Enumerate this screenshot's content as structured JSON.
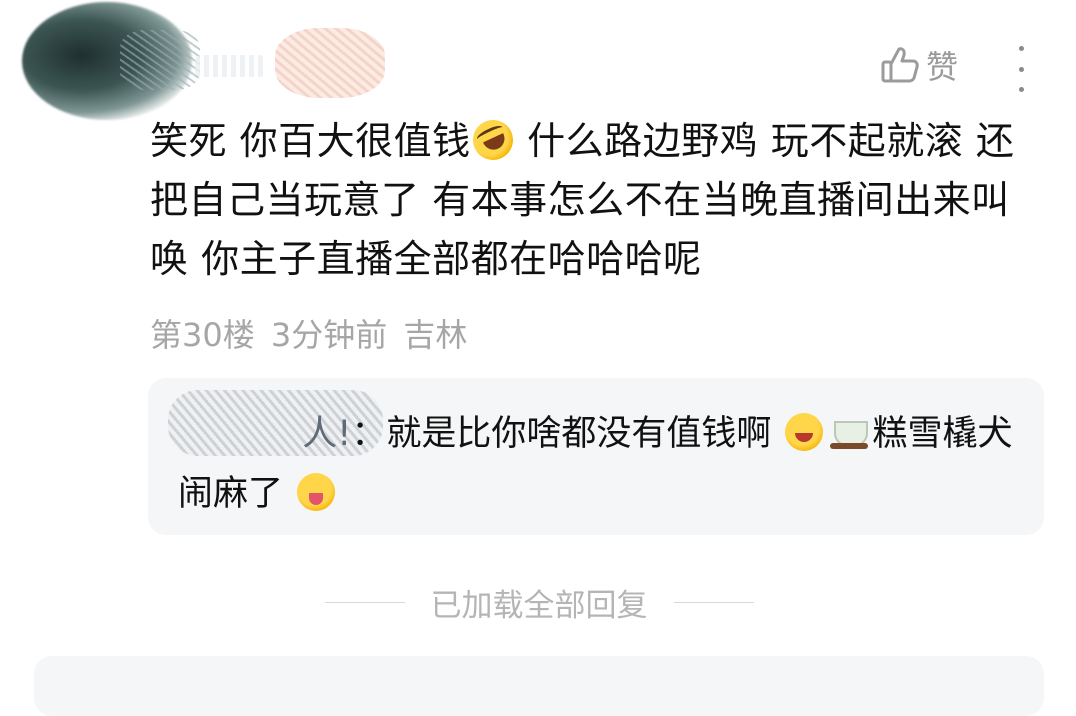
{
  "comment": {
    "like_label": "赞",
    "text_parts": [
      "笑死 你百大很值钱",
      " 什么路边野鸡 玩不起就滚 还把自己当玩意了 有本事怎么不在当晚直播间出来叫唤 你主子直播全部都在哈哈哈呢"
    ],
    "meta": "第30楼 3分钟前 吉林"
  },
  "reply": {
    "author_suffix": "人!",
    "separator": "：",
    "text_parts": [
      "就是比你啥都没有值钱啊",
      "",
      "糕雪橇犬闹麻了"
    ]
  },
  "footer": {
    "loaded_text": "已加载全部回复"
  },
  "icons": {
    "like": "thumbs-up-icon",
    "more": "more-vertical-icon",
    "emoji_laugh": "rolling-laughing-emoji",
    "emoji_grin": "grinning-squint-emoji",
    "emoji_tea": "tea-emoji",
    "emoji_tongue": "savoring-food-emoji"
  }
}
